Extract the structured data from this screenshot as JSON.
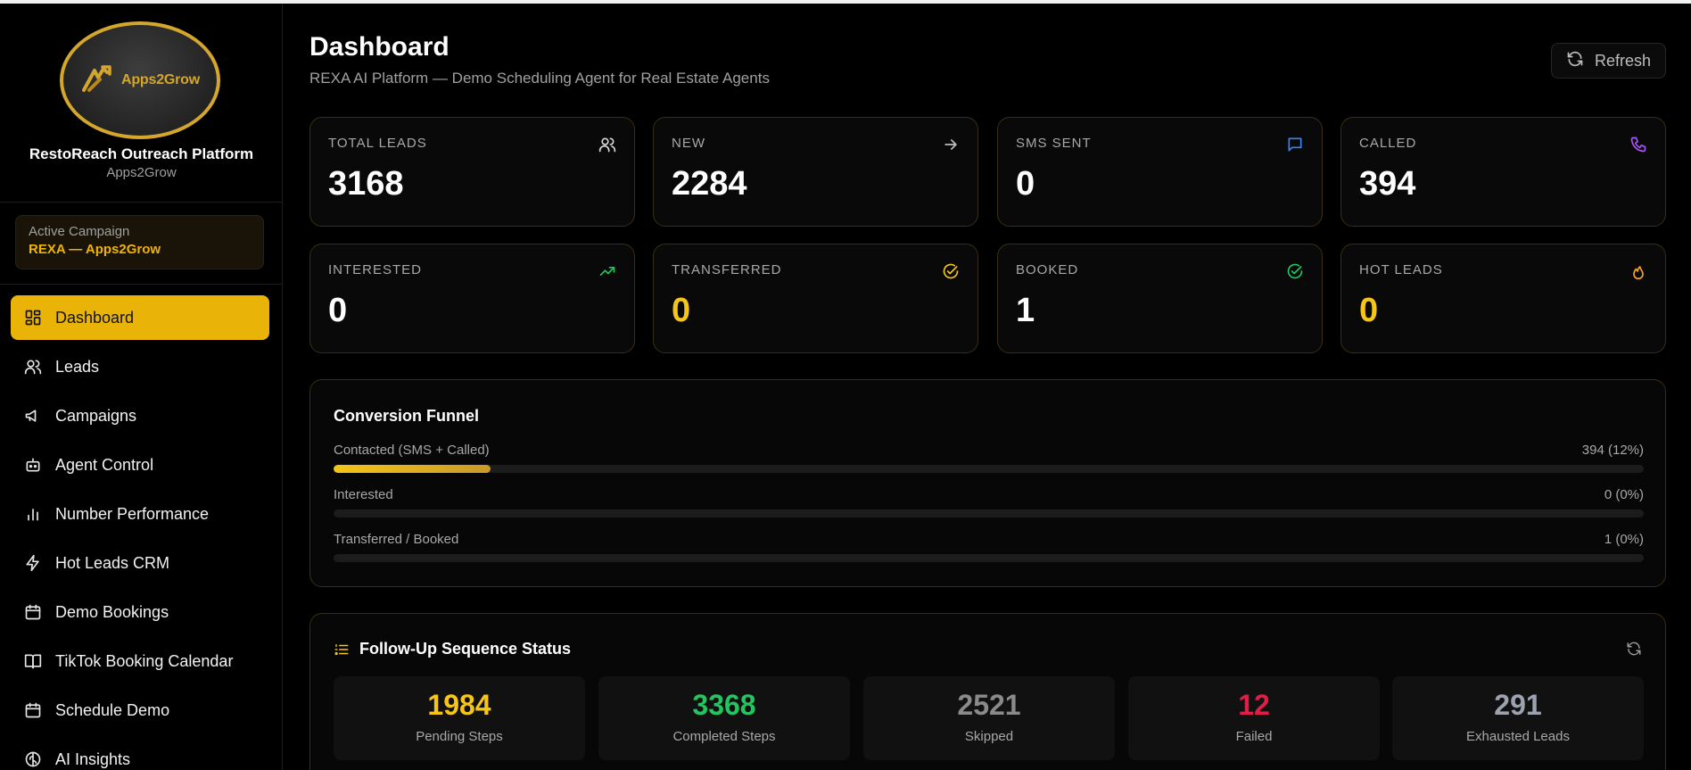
{
  "brand": {
    "logo_text": "Apps2Grow",
    "title": "RestoReach Outreach Platform",
    "subtitle": "Apps2Grow"
  },
  "campaign": {
    "label": "Active Campaign",
    "name": "REXA — Apps2Grow"
  },
  "nav": [
    {
      "label": "Dashboard",
      "icon": "dashboard-grid-icon",
      "active": true
    },
    {
      "label": "Leads",
      "icon": "users-icon"
    },
    {
      "label": "Campaigns",
      "icon": "megaphone-icon"
    },
    {
      "label": "Agent Control",
      "icon": "bot-icon"
    },
    {
      "label": "Number Performance",
      "icon": "bar-chart-icon"
    },
    {
      "label": "Hot Leads CRM",
      "icon": "lightning-icon"
    },
    {
      "label": "Demo Bookings",
      "icon": "calendar-icon"
    },
    {
      "label": "TikTok Booking Calendar",
      "icon": "book-open-icon"
    },
    {
      "label": "Schedule Demo",
      "icon": "calendar-icon"
    },
    {
      "label": "AI Insights",
      "icon": "brain-icon"
    }
  ],
  "header": {
    "title": "Dashboard",
    "subtitle": "REXA AI Platform — Demo Scheduling Agent for Real Estate Agents",
    "refresh_label": "Refresh"
  },
  "stats": [
    {
      "label": "TOTAL LEADS",
      "value": "3168",
      "icon": "users-icon",
      "icon_color": "#d9d9d9",
      "value_color": "#ffffff"
    },
    {
      "label": "NEW",
      "value": "2284",
      "icon": "arrow-right-icon",
      "icon_color": "#bdbdbd",
      "value_color": "#ffffff"
    },
    {
      "label": "SMS SENT",
      "value": "0",
      "icon": "message-square-icon",
      "icon_color": "#3b82f6",
      "value_color": "#ffffff"
    },
    {
      "label": "CALLED",
      "value": "394",
      "icon": "phone-icon",
      "icon_color": "#a855f7",
      "value_color": "#ffffff"
    },
    {
      "label": "INTERESTED",
      "value": "0",
      "icon": "trending-up-icon",
      "icon_color": "#22c55e",
      "value_color": "#ffffff"
    },
    {
      "label": "TRANSFERRED",
      "value": "0",
      "icon": "check-circle-icon",
      "icon_color": "#f5c518",
      "value_color": "#f5c518"
    },
    {
      "label": "BOOKED",
      "value": "1",
      "icon": "check-circle-icon",
      "icon_color": "#22c55e",
      "value_color": "#ffffff"
    },
    {
      "label": "HOT LEADS",
      "value": "0",
      "icon": "flame-icon",
      "icon_color": "#f5a524",
      "value_color": "#f5c518"
    }
  ],
  "funnel": {
    "title": "Conversion Funnel",
    "rows": [
      {
        "label": "Contacted (SMS + Called)",
        "value": "394 (12%)",
        "fraction": 0.12
      },
      {
        "label": "Interested",
        "value": "0 (0%)",
        "fraction": 0
      },
      {
        "label": "Transferred / Booked",
        "value": "1 (0%)",
        "fraction": 0
      }
    ]
  },
  "followup": {
    "title": "Follow-Up Sequence Status",
    "stats": [
      {
        "value": "1984",
        "label": "Pending Steps",
        "color": "#f5c518"
      },
      {
        "value": "3368",
        "label": "Completed Steps",
        "color": "#22c55e"
      },
      {
        "value": "2521",
        "label": "Skipped",
        "color": "#8a8a8a"
      },
      {
        "value": "12",
        "label": "Failed",
        "color": "#e11d48"
      },
      {
        "value": "291",
        "label": "Exhausted Leads",
        "color": "#9ca3af"
      }
    ]
  },
  "colors": {
    "accent": "#eab308",
    "card_border": "#3a2e10"
  }
}
